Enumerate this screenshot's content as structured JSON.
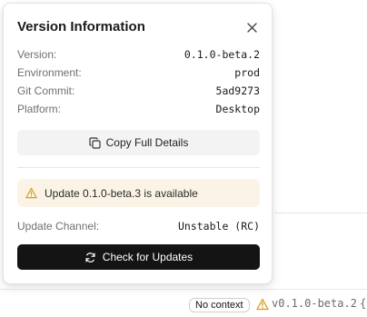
{
  "popover": {
    "title": "Version Information",
    "close_icon": "close-icon",
    "rows": [
      {
        "label": "Version:",
        "value": "0.1.0-beta.2"
      },
      {
        "label": "Environment:",
        "value": "prod"
      },
      {
        "label": "Git Commit:",
        "value": "5ad9273"
      },
      {
        "label": "Platform:",
        "value": "Desktop"
      }
    ],
    "copy_button": {
      "label": "Copy Full Details",
      "icon": "copy-icon"
    },
    "update_banner": {
      "text": "Update 0.1.0-beta.3 is available",
      "icon": "warning-icon",
      "background": "#fbf4e6",
      "icon_color": "#d99a1b"
    },
    "channel": {
      "label": "Update Channel:",
      "value": "Unstable (RC)"
    },
    "check_button": {
      "label": "Check for Updates",
      "icon": "refresh-icon",
      "background": "#141414"
    }
  },
  "status_bar": {
    "context_chip": "No context",
    "warning_icon": "warning-icon",
    "version": "v0.1.0-beta.2",
    "extra_glyph": "{"
  }
}
